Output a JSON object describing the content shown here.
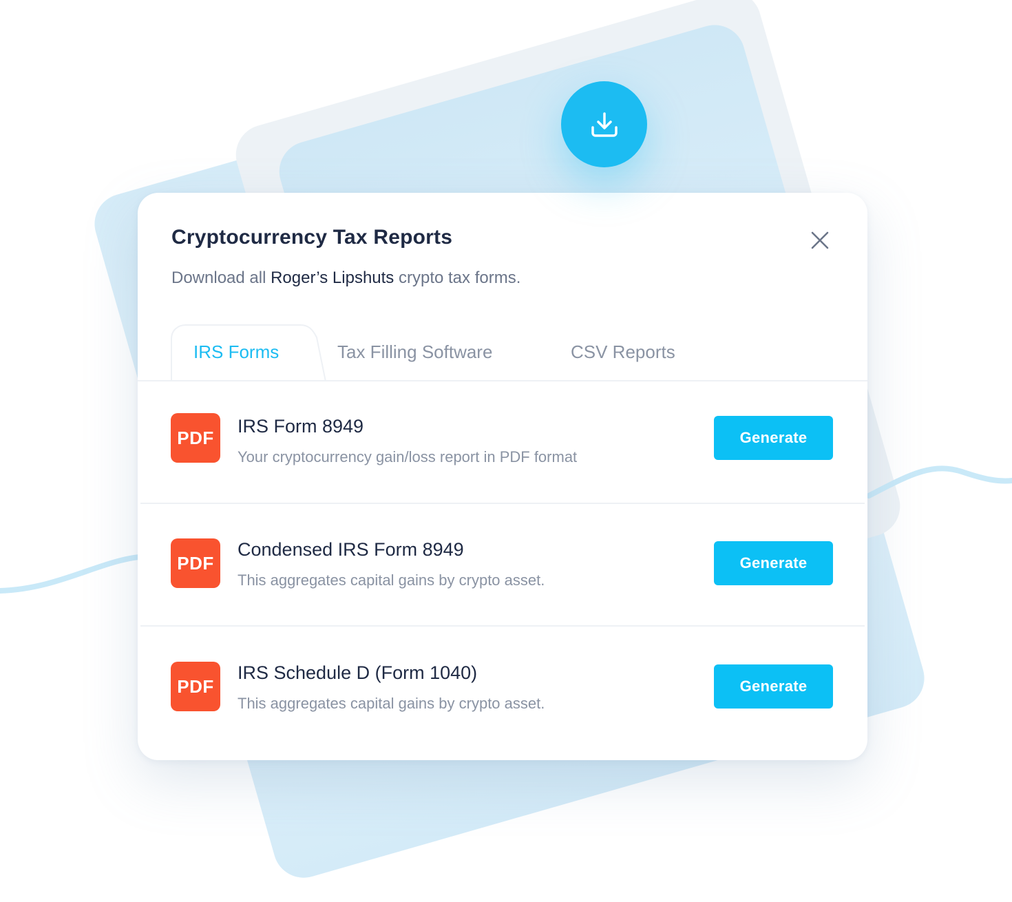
{
  "modal": {
    "title": "Cryptocurrency Tax Reports",
    "subtitle_prefix": "Download all ",
    "subtitle_name": "Roger’s Lipshuts",
    "subtitle_suffix": " crypto tax forms."
  },
  "tabs": [
    {
      "label": "IRS Forms",
      "active": true
    },
    {
      "label": "Tax Filling Software",
      "active": false
    },
    {
      "label": "CSV Reports",
      "active": false
    }
  ],
  "reports": [
    {
      "badge": "PDF",
      "title": "IRS Form 8949",
      "description": "Your cryptocurrency gain/loss report in PDF format",
      "button_label": "Generate"
    },
    {
      "badge": "PDF",
      "title": "Condensed IRS Form 8949",
      "description": "This aggregates capital gains by crypto asset.",
      "button_label": "Generate"
    },
    {
      "badge": "PDF",
      "title": "IRS Schedule D (Form 1040)",
      "description": "This aggregates capital gains by crypto asset.",
      "button_label": "Generate"
    }
  ],
  "icons": {
    "header": "download-icon",
    "close": "close-icon"
  },
  "colors": {
    "accent": "#1cbcf2",
    "button": "#0cc0f5",
    "pdf_badge": "#f9532f",
    "title_text": "#1f2a44",
    "muted_text": "#8a93a3"
  }
}
